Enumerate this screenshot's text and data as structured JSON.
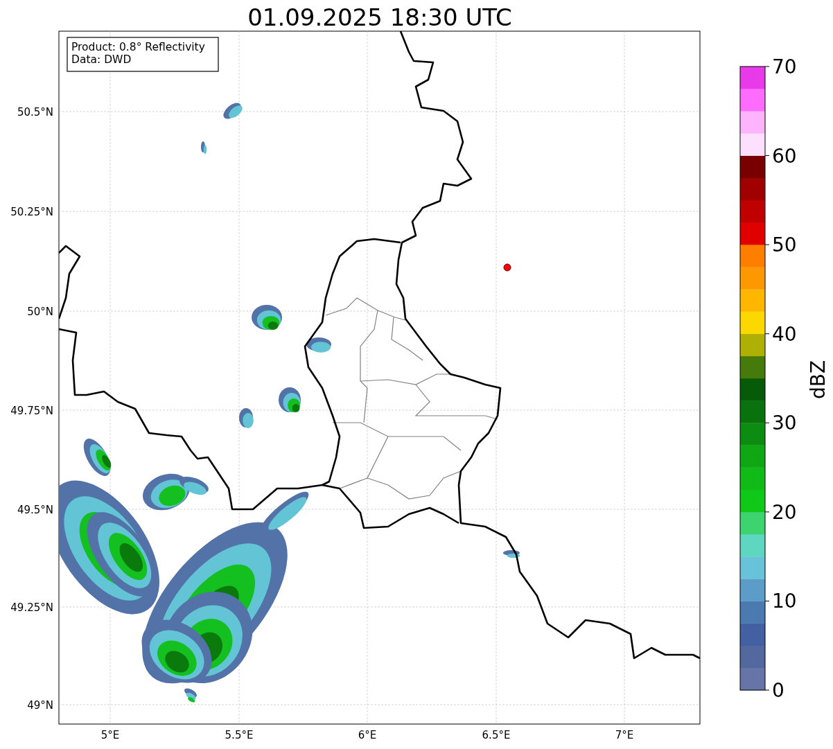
{
  "title": "01.09.2025 18:30 UTC",
  "legend": {
    "lines": [
      "Product: 0.8° Reflectivity",
      "Data: DWD"
    ]
  },
  "map": {
    "yticks": [
      "50.5°N",
      "50.25°N",
      "50°N",
      "49.75°N",
      "49.5°N",
      "49.25°N",
      "49°N"
    ],
    "xticks": [
      "5°E",
      "5.5°E",
      "6°E",
      "6.5°E",
      "7°E"
    ]
  },
  "colorbar": {
    "label": "dBZ",
    "ticks": [
      "70",
      "60",
      "50",
      "40",
      "30",
      "20",
      "10",
      "0"
    ],
    "levels": [
      {
        "color": "#6674a8"
      },
      {
        "color": "#53689e"
      },
      {
        "color": "#4360a3"
      },
      {
        "color": "#4a7ab0"
      },
      {
        "color": "#5b9dc8"
      },
      {
        "color": "#68c3da"
      },
      {
        "color": "#5fd6c0"
      },
      {
        "color": "#3dd470"
      },
      {
        "color": "#10c818"
      },
      {
        "color": "#10bb18"
      },
      {
        "color": "#0fa814"
      },
      {
        "color": "#0c8c10"
      },
      {
        "color": "#0a720c"
      },
      {
        "color": "#075a07"
      },
      {
        "color": "#467a0a"
      },
      {
        "color": "#aeb005"
      },
      {
        "color": "#fdd700"
      },
      {
        "color": "#feb700"
      },
      {
        "color": "#fe9800"
      },
      {
        "color": "#fe7e00"
      },
      {
        "color": "#e00000"
      },
      {
        "color": "#c00000"
      },
      {
        "color": "#a00000"
      },
      {
        "color": "#780000"
      },
      {
        "color": "#fde0fd"
      },
      {
        "color": "#fdb4fd"
      },
      {
        "color": "#fd6cfd"
      },
      {
        "color": "#e83ae8"
      }
    ]
  }
}
